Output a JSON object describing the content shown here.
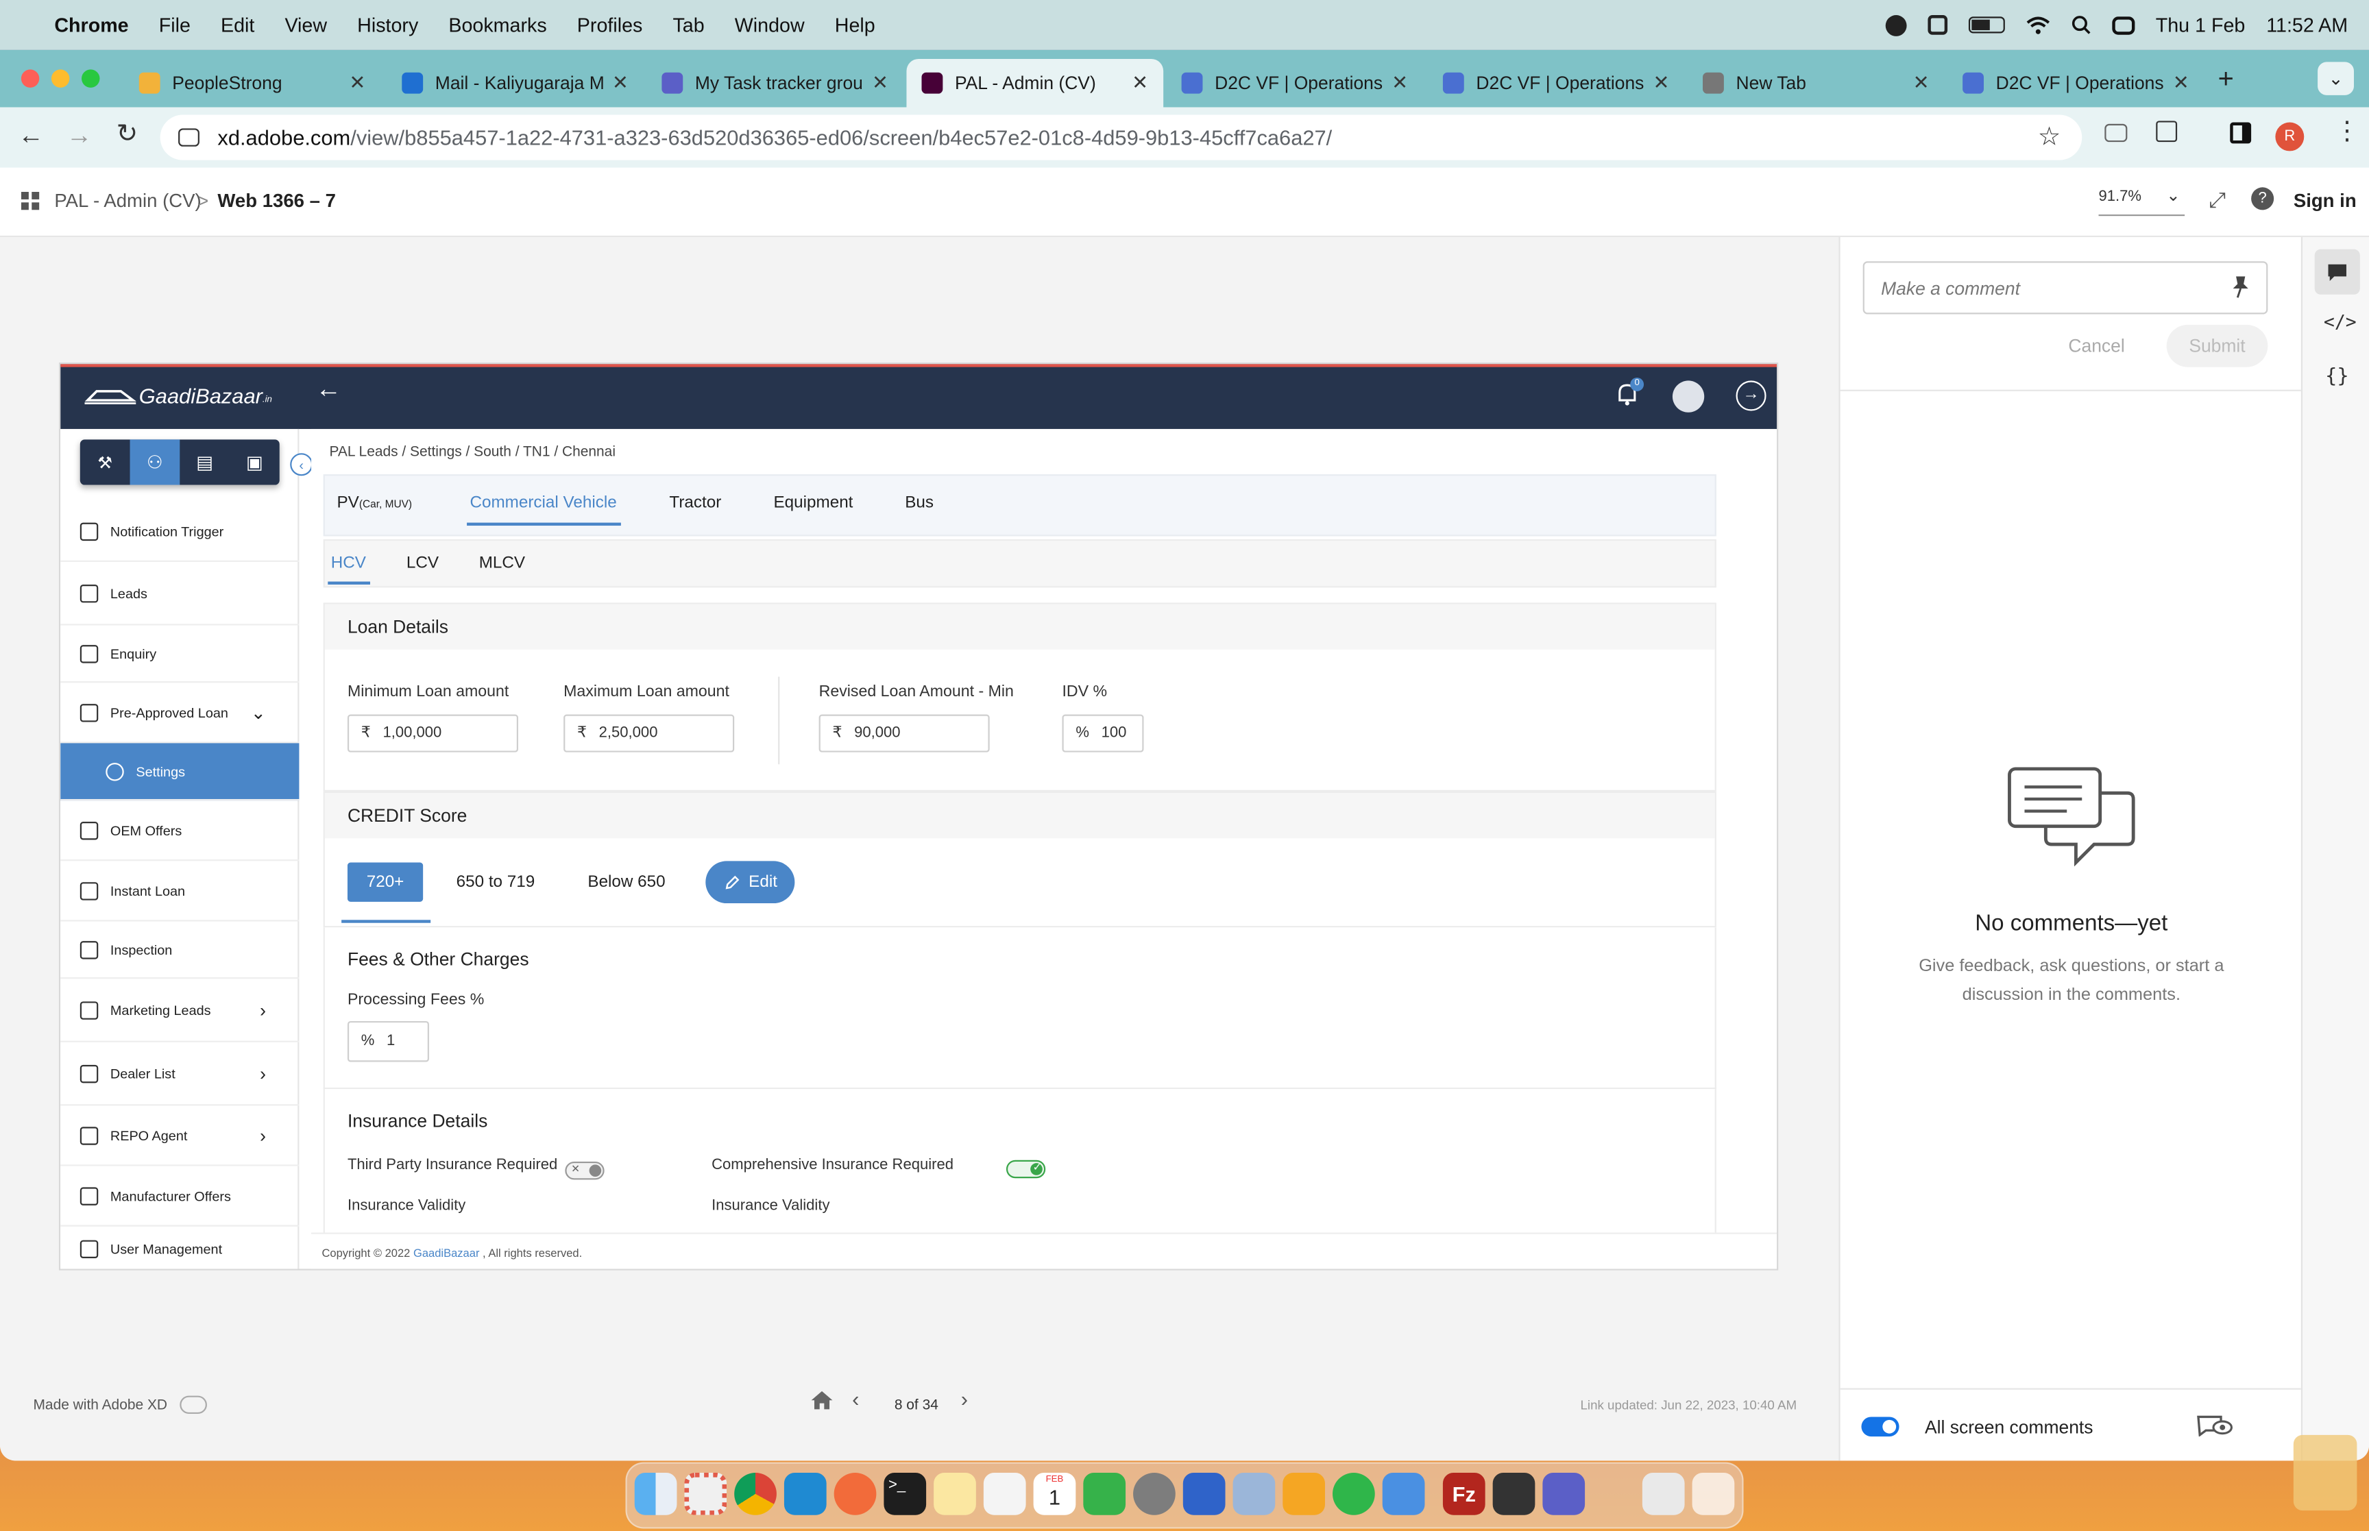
{
  "menubar": {
    "app": "Chrome",
    "items": [
      "File",
      "Edit",
      "View",
      "History",
      "Bookmarks",
      "Profiles",
      "Tab",
      "Window",
      "Help"
    ],
    "date": "Thu 1 Feb",
    "time": "11:52 AM"
  },
  "tabs": [
    {
      "title": "PeopleStrong",
      "color": "#f2b23a"
    },
    {
      "title": "Mail - Kaliyugaraja M",
      "color": "#1f6fd1"
    },
    {
      "title": "My Task tracker grou",
      "color": "#5b5fc7"
    },
    {
      "title": "PAL - Admin (CV)",
      "color": "#470137",
      "active": true
    },
    {
      "title": "D2C VF | Operations",
      "color": "#4a6fd1"
    },
    {
      "title": "D2C VF | Operations",
      "color": "#4a6fd1"
    },
    {
      "title": "New Tab",
      "color": "#777777"
    },
    {
      "title": "D2C VF | Operations",
      "color": "#4a6fd1"
    }
  ],
  "url": {
    "host": "xd.adobe.com",
    "path": "/view/b855a457-1a22-4731-a323-63d520d36365-ed06/screen/b4ec57e2-01c8-4d59-9b13-45cff7ca6a27/"
  },
  "profile_initial": "R",
  "xd": {
    "project": "PAL - Admin (CV)",
    "sep": ">",
    "screen": "Web 1366 – 7",
    "zoom": "91.7%",
    "sign_in": "Sign in"
  },
  "comments": {
    "placeholder": "Make a comment",
    "cancel": "Cancel",
    "submit": "Submit",
    "empty_title": "No comments—yet",
    "empty_body": "Give feedback, ask questions, or start a discussion in the comments.",
    "toggle_label": "All screen comments"
  },
  "footer": {
    "made_with": "Made with Adobe XD",
    "pager": "8 of 34",
    "link_updated": "Link updated: Jun 22, 2023, 10:40 AM"
  },
  "artboard": {
    "logo": "GaadiBazaar",
    "logo_suffix": ".in",
    "notif_count": "0",
    "breadcrumb": "PAL Leads / Settings / South / TN1 / Chennai",
    "sidebar": [
      {
        "label": "Notification Trigger"
      },
      {
        "label": "Leads"
      },
      {
        "label": "Enquiry"
      },
      {
        "label": "Pre-Approved Loan"
      },
      {
        "label": "Settings"
      },
      {
        "label": "OEM Offers"
      },
      {
        "label": "Instant Loan"
      },
      {
        "label": "Inspection"
      },
      {
        "label": "Marketing Leads"
      },
      {
        "label": "Dealer List"
      },
      {
        "label": "REPO Agent"
      },
      {
        "label": "Manufacturer Offers"
      },
      {
        "label": "User Management"
      }
    ],
    "vtabs": {
      "pv": "PV",
      "pv_sub": "(Car, MUV)",
      "cv": "Commercial Vehicle",
      "tractor": "Tractor",
      "equipment": "Equipment",
      "bus": "Bus"
    },
    "subtabs": [
      "HCV",
      "LCV",
      "MLCV"
    ],
    "loan": {
      "title": "Loan Details",
      "min_label": "Minimum Loan amount",
      "min_prefix": "₹",
      "min_value": "1,00,000",
      "max_label": "Maximum Loan amount",
      "max_prefix": "₹",
      "max_value": "2,50,000",
      "rev_label": "Revised Loan Amount - Min",
      "rev_prefix": "₹",
      "rev_value": "90,000",
      "idv_label": "IDV %",
      "idv_prefix": "%",
      "idv_value": "100"
    },
    "credit": {
      "title": "CREDIT Score",
      "tabs": [
        "720+",
        "650 to 719",
        "Below 650"
      ],
      "edit": "Edit"
    },
    "fees": {
      "title": "Fees & Other Charges",
      "proc_label": "Processing Fees %",
      "proc_prefix": "%",
      "proc_value": "1"
    },
    "insurance": {
      "title": "Insurance Details",
      "third_party": "Third Party Insurance Required",
      "comprehensive": "Comprehensive Insurance Required",
      "validity1": "Insurance Validity",
      "validity2": "Insurance Validity",
      "toggle_off_mark": "✕",
      "toggle_on_mark": "✓"
    },
    "copyright_pre": "Copyright © 2022 ",
    "copyright_link": "GaadiBazaar",
    "copyright_post": " , All rights reserved."
  },
  "dock_calendar": {
    "month": "FEB",
    "day": "1"
  },
  "colors": {
    "accent": "#4a86c8",
    "header": "#26344d",
    "active_side": "#4a86c8",
    "xd_blue": "#1473e6"
  }
}
